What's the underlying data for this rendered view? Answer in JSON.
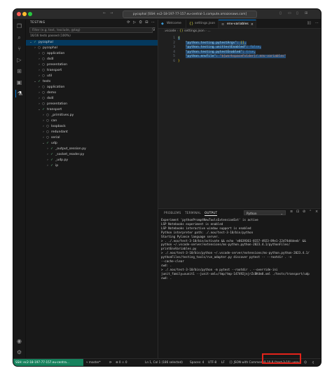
{
  "window": {
    "command_center": "pycophal [SSH: ec2-18-197-77-157.eu-central-1.compute.amazonaws.com]"
  },
  "activity_bar": {
    "icons": [
      "files-icon",
      "search-icon",
      "source-control-icon",
      "run-debug-icon",
      "extensions-icon",
      "remote-explorer-icon",
      "testing-icon"
    ],
    "bottom_icons": [
      "account-icon",
      "settings-gear-icon"
    ]
  },
  "sidebar": {
    "title": "TESTING",
    "filter_placeholder": "Filter (e.g. text, !exclude, @tag)",
    "summary": "16/16 tests passed (100%)",
    "tree": [
      {
        "label": "pycophal",
        "depth": 0,
        "expanded": true,
        "status": "pass"
      },
      {
        "label": "pycophal",
        "depth": 1,
        "expanded": false,
        "status": "none"
      },
      {
        "label": "application",
        "depth": 2,
        "expanded": false,
        "status": "none"
      },
      {
        "label": "dsdl",
        "depth": 2,
        "expanded": false,
        "status": "none"
      },
      {
        "label": "presentation",
        "depth": 2,
        "expanded": false,
        "status": "none"
      },
      {
        "label": "transport",
        "depth": 2,
        "expanded": false,
        "status": "none"
      },
      {
        "label": "util",
        "depth": 2,
        "expanded": false,
        "status": "none"
      },
      {
        "label": "tests",
        "depth": 1,
        "expanded": true,
        "status": "pass"
      },
      {
        "label": "application",
        "depth": 2,
        "expanded": false,
        "status": "none"
      },
      {
        "label": "demo",
        "depth": 2,
        "expanded": false,
        "status": "none"
      },
      {
        "label": "dsdl",
        "depth": 2,
        "expanded": false,
        "status": "none"
      },
      {
        "label": "presentation",
        "depth": 2,
        "expanded": false,
        "status": "none"
      },
      {
        "label": "transport",
        "depth": 2,
        "expanded": true,
        "status": "pass"
      },
      {
        "label": "_primitives.py",
        "depth": 3,
        "expanded": false,
        "status": "none"
      },
      {
        "label": "can",
        "depth": 3,
        "expanded": false,
        "status": "none"
      },
      {
        "label": "loopback",
        "depth": 3,
        "expanded": false,
        "status": "none"
      },
      {
        "label": "redundant",
        "depth": 3,
        "expanded": false,
        "status": "none"
      },
      {
        "label": "serial",
        "depth": 3,
        "expanded": false,
        "status": "none"
      },
      {
        "label": "udp",
        "depth": 3,
        "expanded": true,
        "status": "pass"
      },
      {
        "label": "_output_session.py",
        "depth": 4,
        "expanded": false,
        "status": "pass"
      },
      {
        "label": "_socket_reader.py",
        "depth": 4,
        "expanded": false,
        "status": "pass"
      },
      {
        "label": "_udp.py",
        "depth": 4,
        "expanded": false,
        "status": "pass"
      },
      {
        "label": "ip",
        "depth": 4,
        "expanded": false,
        "status": "pass"
      }
    ]
  },
  "editor": {
    "tabs": [
      {
        "label": "Welcome",
        "icon": "vscode-icon"
      },
      {
        "label": "settings.json",
        "icon": "json-icon"
      },
      {
        "label": "env-variables",
        "icon": "settings-icon",
        "active": true
      }
    ],
    "breadcrumb": [
      ".vscode",
      "settings.json",
      "..."
    ],
    "lines": [
      {
        "n": "1",
        "text": "{"
      },
      {
        "n": "2",
        "key": "\"python.testing.pytestArgs\"",
        "value": "[]",
        "tail": ","
      },
      {
        "n": "3",
        "key": "\"python.testing.unittestEnabled\"",
        "value": "false",
        "tail": ","
      },
      {
        "n": "4",
        "key": "\"python.testing.pytestEnabled\"",
        "value": "true",
        "tail": ","
      },
      {
        "n": "5",
        "key": "\"python.envFile\"",
        "value": "\"${workspaceFolder}/.env-variables\"",
        "tail": ""
      },
      {
        "n": "6",
        "text": "}"
      }
    ]
  },
  "panel": {
    "tabs": [
      "PROBLEMS",
      "TERMINAL",
      "OUTPUT"
    ],
    "active_tab": "OUTPUT",
    "channel": "Python",
    "lines": [
      "Experiment 'pythonPromptNewToolsExtensionExt' is active",
      "LSP Notebooks experiment is enabled",
      "LSP Notebooks interactive window support is enabled",
      "Python interpreter path: ./.nox/test-3-10/bin/python",
      "Starting Pylance language server.",
      "> . ./.nox/test-3-10/bin/activate && echo 'e8639361-8157-4923-89e1-22d74d4deeb' &&",
      "python ~/.vscode-server/extensions/ms-python.python-2023.4.1/pythonFiles/",
      "printEnvVariables.py",
      "> ./.nox/test-3-10/bin/python ~/.vscode-server/extensions/ms-python.python-2023.4.1/",
      "pythonFiles/testing_tools/run_adapter.py discover pytest -- --rootdir . -s",
      "--cache-clear",
      "cwd: .",
      "> ./.nox/test-3-10/bin/python -m pytest --rootdir . --override-ini",
      "junit_family=xunit1 --junit-xml=/tmp/tmp-147492jnjrZcBK4m8.xml ./tests/transport/udp",
      "cwd: ."
    ]
  },
  "status_bar": {
    "remote": "SSH: ec2-18-197-77-157.eu-centra...",
    "branch": "master*",
    "sync": "⟳",
    "problems": "⊗ 0 ⚠ 0",
    "cursor": "Ln 1, Col 1 (186 selected)",
    "spaces": "Spaces: 4",
    "encoding": "UTF-8",
    "eol": "LF",
    "language": "{} JSON with Comments",
    "interpreter": "3.10.8 ('test-3-10': venv)"
  },
  "colors": {
    "accent": "#0078d4",
    "pass": "#73c991",
    "remote": "#16825d",
    "highlight_box": "#e2231a"
  }
}
